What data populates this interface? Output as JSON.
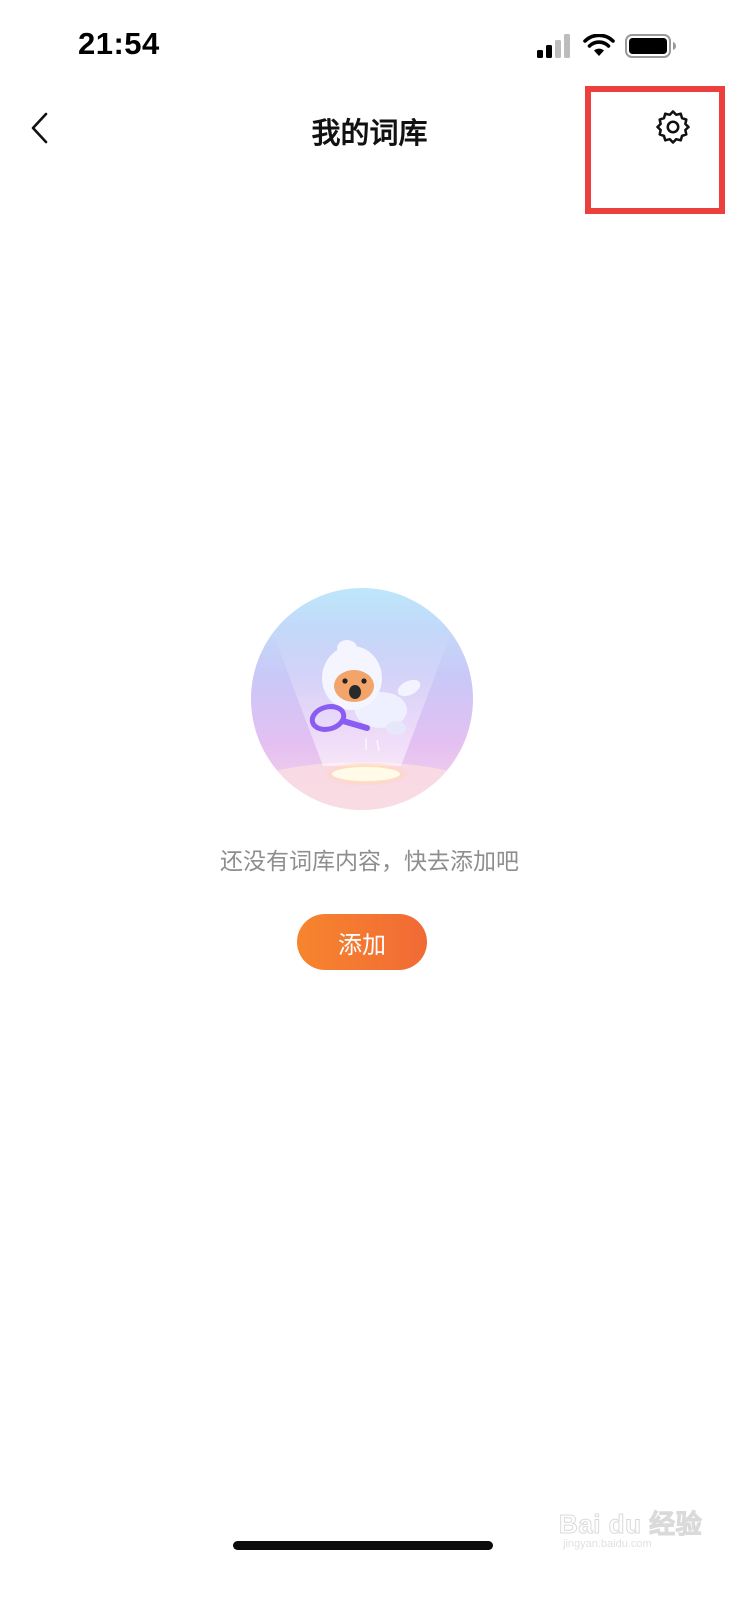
{
  "status_bar": {
    "time": "21:54",
    "icons": [
      "signal-icon",
      "wifi-icon",
      "battery-icon"
    ]
  },
  "nav_bar": {
    "back_icon": "chevron-left-icon",
    "title": "我的词库",
    "settings_icon": "gear-icon"
  },
  "empty_state": {
    "illustration": "astronaut-mascot-with-magnifier",
    "message": "还没有词库内容，快去添加吧",
    "add_button_label": "添加"
  },
  "watermark": {
    "text": "Bai du 经验",
    "sub_text": "jingyan.baidu.com"
  },
  "colors": {
    "accent_orange_start": "#f6852d",
    "accent_orange_end": "#f16a36",
    "highlight_red": "#ee3f3f",
    "empty_text_gray": "#8e8e8e"
  }
}
